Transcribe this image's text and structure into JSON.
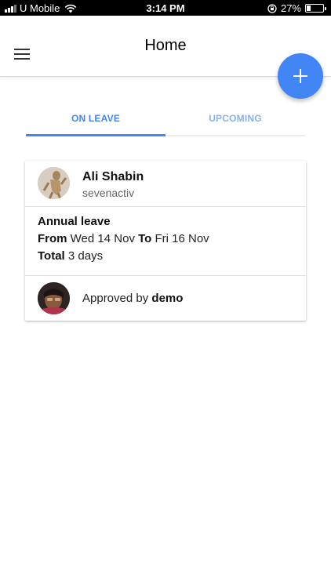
{
  "status_bar": {
    "carrier": "U Mobile",
    "time": "3:14 PM",
    "battery": "27%",
    "battery_level": 0.27,
    "icons": [
      "signal-icon",
      "wifi-icon",
      "rotation-lock-icon",
      "battery-icon"
    ]
  },
  "header": {
    "title": "Home",
    "menu_icon": "hamburger-menu-icon",
    "fab_icon": "plus-icon"
  },
  "tabs": [
    {
      "label": "ON LEAVE",
      "active": true
    },
    {
      "label": "UPCOMING",
      "active": false
    }
  ],
  "colors": {
    "accent": "#4285f4",
    "tab_inactive": "#8ab0e8"
  },
  "leave_card": {
    "user": {
      "name": "Ali Shabin",
      "subtitle": "sevenactiv"
    },
    "leave_type": "Annual leave",
    "from_label": "From",
    "from_date": "Wed 14 Nov",
    "to_label": "To",
    "to_date": "Fri 16 Nov",
    "total_label": "Total",
    "total_value": "3 days",
    "approval": {
      "prefix": "Approved by",
      "approver": "demo"
    }
  }
}
